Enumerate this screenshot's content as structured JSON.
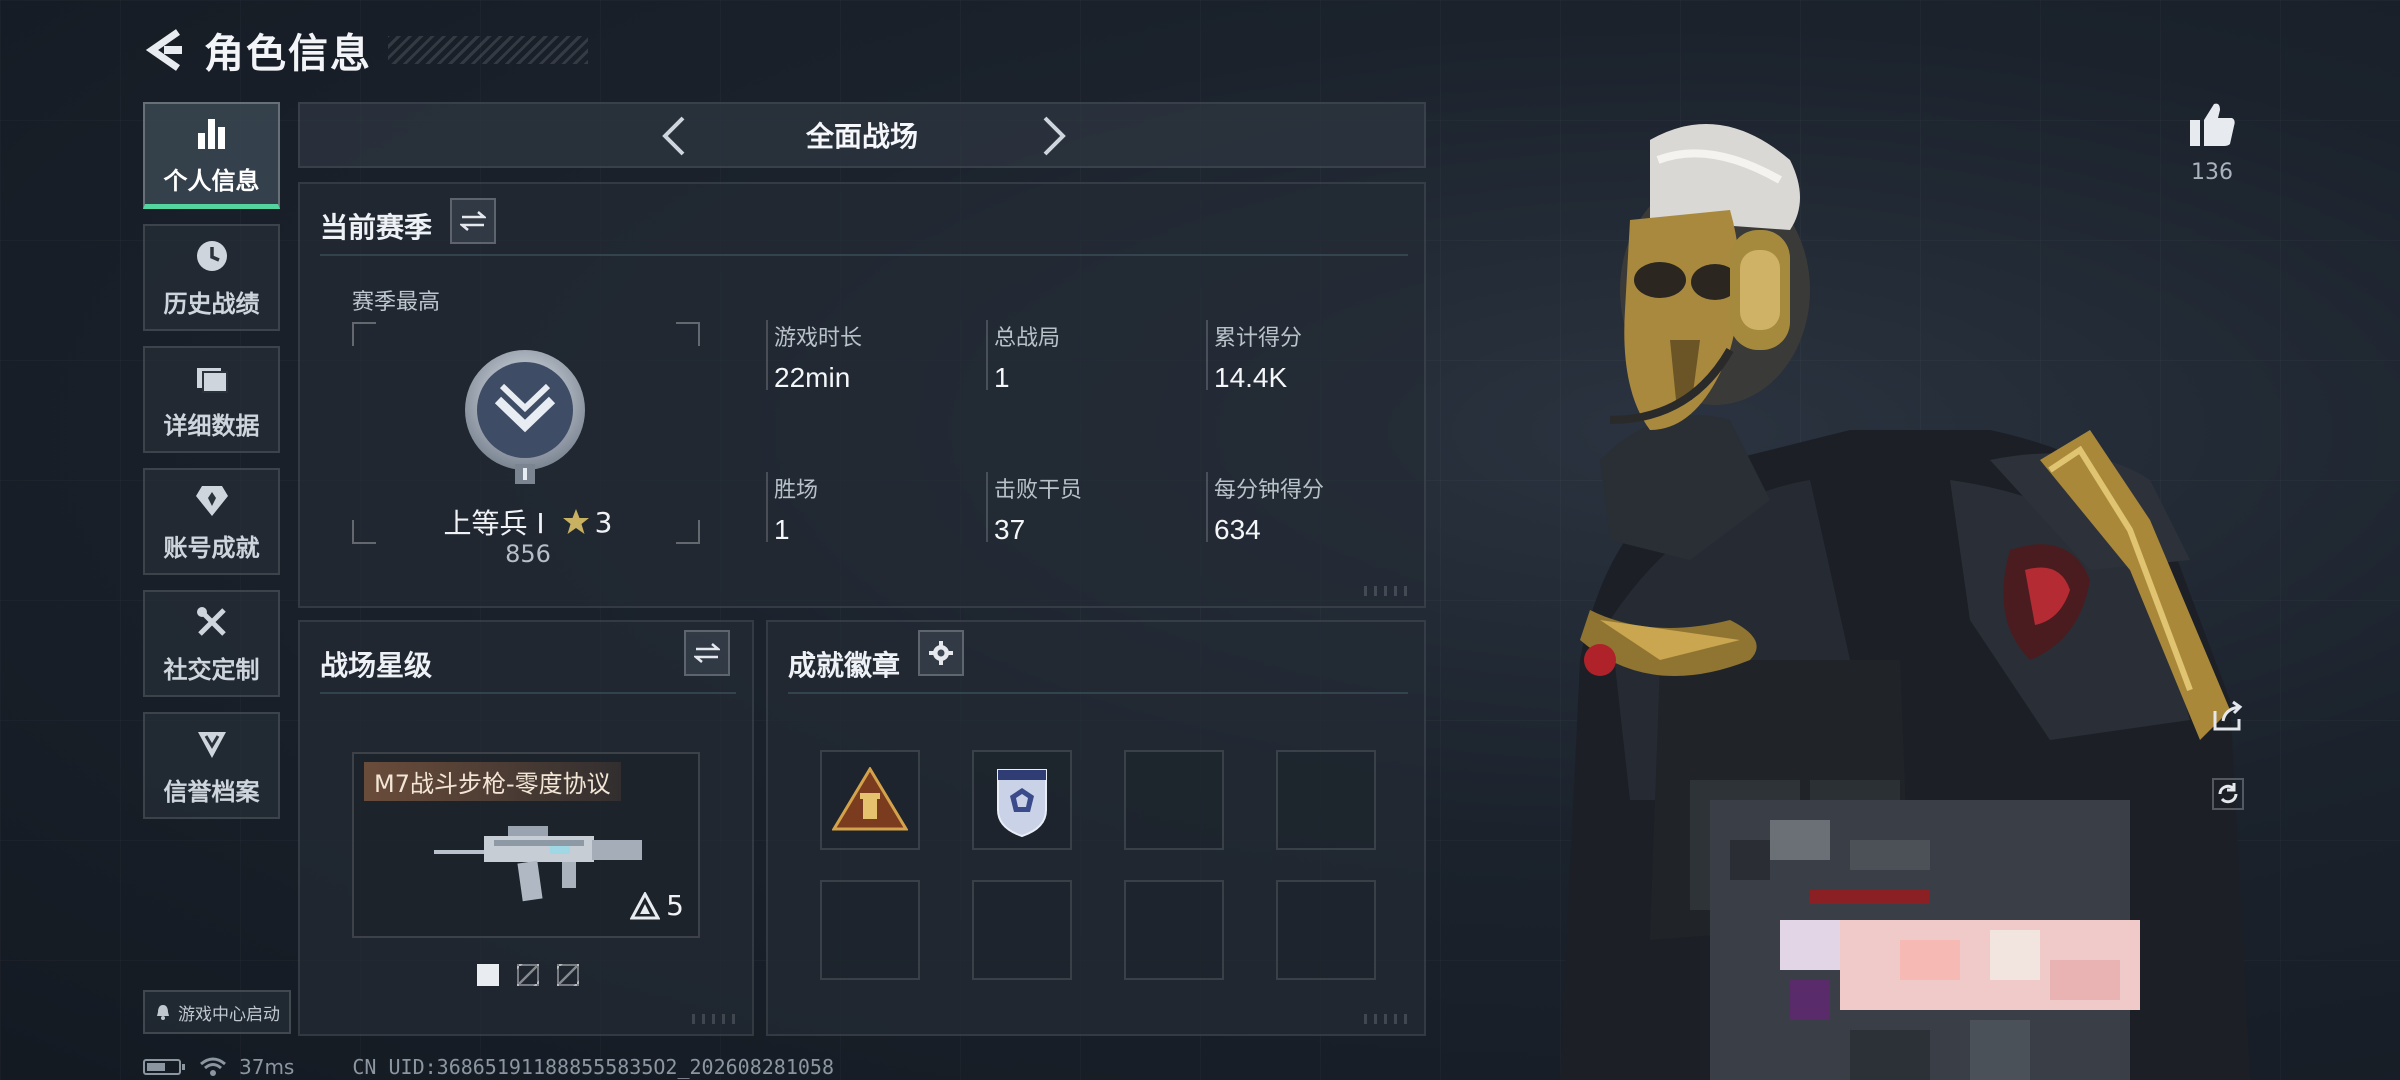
{
  "header": {
    "title": "角色信息"
  },
  "nav": {
    "items": [
      {
        "label": "个人信息",
        "icon": "bar-chart-icon"
      },
      {
        "label": "历史战绩",
        "icon": "clock-icon"
      },
      {
        "label": "详细数据",
        "icon": "folder-icon"
      },
      {
        "label": "账号成就",
        "icon": "achievement-icon"
      },
      {
        "label": "社交定制",
        "icon": "tools-icon"
      },
      {
        "label": "信誉档案",
        "icon": "reputation-icon"
      }
    ],
    "game_center": "游戏中心启动"
  },
  "status": {
    "ping": "37ms",
    "uid": "CN UID:368651911888555835O2_202608281058"
  },
  "mode": {
    "title": "全面战场"
  },
  "season": {
    "title": "当前赛季",
    "best_label": "赛季最高",
    "rank_name": "上等兵 Ⅰ",
    "rank_stars": "3",
    "rank_points": "856",
    "stats": [
      {
        "label": "游戏时长",
        "value": "22min"
      },
      {
        "label": "总战局",
        "value": "1"
      },
      {
        "label": "累计得分",
        "value": "14.4K"
      },
      {
        "label": "胜场",
        "value": "1"
      },
      {
        "label": "击败干员",
        "value": "37"
      },
      {
        "label": "每分钟得分",
        "value": "634"
      }
    ]
  },
  "battle_star": {
    "title": "战场星级",
    "weapon_name": "M7战斗步枪-零度协议",
    "weapon_stars": "5"
  },
  "achievements": {
    "title": "成就徽章"
  },
  "profile": {
    "likes": "136"
  },
  "colors": {
    "accent": "#54d5a0",
    "background": "#1b222c"
  }
}
